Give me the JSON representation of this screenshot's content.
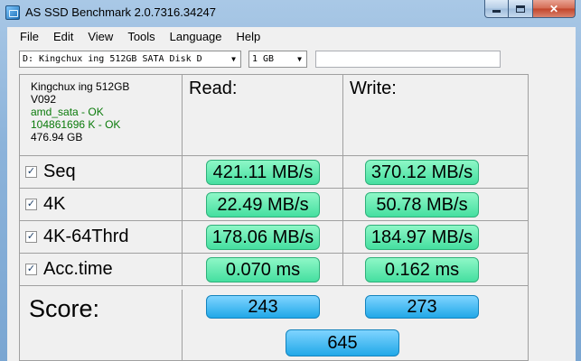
{
  "window": {
    "title": "AS SSD Benchmark 2.0.7316.34247"
  },
  "menu": [
    "File",
    "Edit",
    "View",
    "Tools",
    "Language",
    "Help"
  ],
  "toolbar": {
    "disk_select": "D: Kingchux ing 512GB SATA Disk D",
    "size_select": "1 GB",
    "text_field": ""
  },
  "drive_info": {
    "name": "Kingchux ing 512GB",
    "firmware": "V092",
    "driver": "amd_sata - OK",
    "alignment": "104861696 K - OK",
    "capacity": "476.94 GB"
  },
  "headers": {
    "read": "Read:",
    "write": "Write:"
  },
  "rows": [
    {
      "label": "Seq",
      "checked": true,
      "read": "421.11 MB/s",
      "write": "370.12 MB/s"
    },
    {
      "label": "4K",
      "checked": true,
      "read": "22.49 MB/s",
      "write": "50.78 MB/s"
    },
    {
      "label": "4K-64Thrd",
      "checked": true,
      "read": "178.06 MB/s",
      "write": "184.97 MB/s"
    },
    {
      "label": "Acc.time",
      "checked": true,
      "read": "0.070 ms",
      "write": "0.162 ms"
    }
  ],
  "score": {
    "label": "Score:",
    "read": "243",
    "write": "273",
    "total": "645"
  },
  "colors": {
    "green_pill": "#45dfa0",
    "blue_pill": "#21a8e8",
    "ok_text": "#0a7a0a"
  }
}
